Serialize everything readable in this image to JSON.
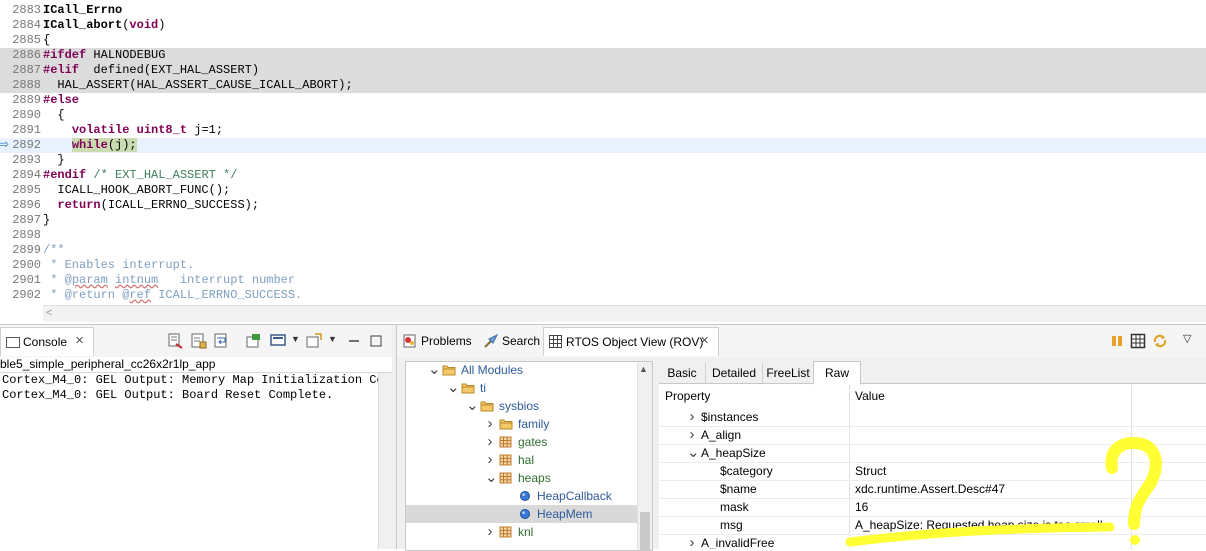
{
  "editor": {
    "lines": [
      {
        "num": "2883",
        "segments": [
          {
            "t": "ICall_Errno",
            "c": "fnb"
          }
        ]
      },
      {
        "num": "2884",
        "segments": [
          {
            "t": "ICall_abort",
            "c": "fnb"
          },
          {
            "t": "("
          },
          {
            "t": "void",
            "c": "kw"
          },
          {
            "t": ")"
          }
        ]
      },
      {
        "num": "2885",
        "segments": [
          {
            "t": "{"
          }
        ]
      },
      {
        "num": "2886",
        "bg": "shade",
        "segments": [
          {
            "t": "#ifdef",
            "c": "pp"
          },
          {
            "t": " HALNODEBUG"
          }
        ]
      },
      {
        "num": "2887",
        "bg": "shade",
        "segments": [
          {
            "t": "#elif",
            "c": "pp"
          },
          {
            "t": "  defined(EXT_HAL_ASSERT)"
          }
        ]
      },
      {
        "num": "2888",
        "bg": "shade",
        "segments": [
          {
            "t": "  HAL_ASSERT(HAL_ASSERT_CAUSE_ICALL_ABORT);"
          }
        ]
      },
      {
        "num": "2889",
        "segments": [
          {
            "t": "#else",
            "c": "pp"
          }
        ]
      },
      {
        "num": "2890",
        "segments": [
          {
            "t": "  {"
          }
        ]
      },
      {
        "num": "2891",
        "segments": [
          {
            "t": "    "
          },
          {
            "t": "volatile",
            "c": "kw"
          },
          {
            "t": " "
          },
          {
            "t": "uint8_t",
            "c": "kw"
          },
          {
            "t": " j=1;"
          }
        ]
      },
      {
        "num": "2892",
        "bg": "current",
        "segments": [
          {
            "t": "    "
          },
          {
            "t": "while",
            "c": "kw hl-while"
          },
          {
            "t": "(j);",
            "c": "hl-while"
          }
        ]
      },
      {
        "num": "2893",
        "segments": [
          {
            "t": "  }"
          }
        ]
      },
      {
        "num": "2894",
        "segments": [
          {
            "t": "#endif",
            "c": "pp"
          },
          {
            "t": " /* EXT_HAL_ASSERT */",
            "c": "cm"
          }
        ]
      },
      {
        "num": "2895",
        "segments": [
          {
            "t": "  ICALL_HOOK_ABORT_FUNC();"
          }
        ]
      },
      {
        "num": "2896",
        "segments": [
          {
            "t": "  "
          },
          {
            "t": "return",
            "c": "kw"
          },
          {
            "t": "(ICALL_ERRNO_SUCCESS);"
          }
        ]
      },
      {
        "num": "2897",
        "segments": [
          {
            "t": "}"
          }
        ]
      },
      {
        "num": "2898",
        "segments": []
      },
      {
        "num": "2899",
        "segments": [
          {
            "t": "/**",
            "c": "jd"
          }
        ]
      },
      {
        "num": "2900",
        "segments": [
          {
            "t": " * Enables interrupt.",
            "c": "jd"
          }
        ]
      },
      {
        "num": "2901",
        "segments": [
          {
            "t": " * @",
            "c": "jd"
          },
          {
            "t": "param",
            "c": "jd squig"
          },
          {
            "t": " ",
            "c": "jd"
          },
          {
            "t": "intnum",
            "c": "jd squig"
          },
          {
            "t": "   interrupt number",
            "c": "jd"
          }
        ]
      },
      {
        "num": "2902",
        "segments": [
          {
            "t": " * @return @",
            "c": "jd"
          },
          {
            "t": "ref",
            "c": "jd squig"
          },
          {
            "t": " ICALL_ERRNO_SUCCESS.",
            "c": "jd"
          }
        ]
      }
    ],
    "scroll_left": "<"
  },
  "console": {
    "tab_label": "Console",
    "close": "✕",
    "subtitle": "ble5_simple_peripheral_cc26x2r1lp_app",
    "lines": [
      "Cortex_M4_0: GEL Output: Memory Map Initialization Co",
      "Cortex_M4_0: GEL Output: Board Reset Complete."
    ]
  },
  "rov": {
    "tabs": {
      "problems": "Problems",
      "search": "Search",
      "rov": "RTOS Object View (ROV)",
      "close": "✕"
    },
    "tree": [
      {
        "label": "All Modules",
        "level": 0,
        "tw": "v",
        "icon": "folder",
        "type": "folder"
      },
      {
        "label": "ti",
        "level": 1,
        "tw": "v",
        "icon": "folder",
        "type": "folder"
      },
      {
        "label": "sysbios",
        "level": 2,
        "tw": "v",
        "icon": "folder",
        "type": "folder"
      },
      {
        "label": "family",
        "level": 3,
        "tw": ">",
        "icon": "folder",
        "type": "folder"
      },
      {
        "label": "gates",
        "level": 3,
        "tw": ">",
        "icon": "grid",
        "type": "mod"
      },
      {
        "label": "hal",
        "level": 3,
        "tw": ">",
        "icon": "grid",
        "type": "mod"
      },
      {
        "label": "heaps",
        "level": 3,
        "tw": "v",
        "icon": "grid",
        "type": "mod"
      },
      {
        "label": "HeapCallback",
        "level": 4,
        "tw": "",
        "icon": "dot",
        "type": "leaf"
      },
      {
        "label": "HeapMem",
        "level": 4,
        "tw": "",
        "icon": "dot",
        "type": "leaf",
        "selected": true
      },
      {
        "label": "knl",
        "level": 3,
        "tw": ">",
        "icon": "grid",
        "type": "mod"
      }
    ],
    "ptabs": [
      "Basic",
      "Detailed",
      "FreeList",
      "Raw"
    ],
    "active_ptab": "Raw",
    "headers": {
      "property": "Property",
      "value": "Value"
    },
    "rows": [
      {
        "prop": "$instances",
        "value": "",
        "level": 0,
        "tw": ">"
      },
      {
        "prop": "A_align",
        "value": "",
        "level": 0,
        "tw": ">"
      },
      {
        "prop": "A_heapSize",
        "value": "",
        "level": 0,
        "tw": "v"
      },
      {
        "prop": "$category",
        "value": "Struct",
        "level": 1,
        "tw": ""
      },
      {
        "prop": "$name",
        "value": "xdc.runtime.Assert.Desc#47",
        "level": 1,
        "tw": ""
      },
      {
        "prop": "mask",
        "value": "16",
        "level": 1,
        "tw": ""
      },
      {
        "prop": "msg",
        "value": "A_heapSize: Requested heap size is too small",
        "level": 1,
        "tw": ""
      },
      {
        "prop": "A_invalidFree",
        "value": "",
        "level": 0,
        "tw": ">"
      }
    ]
  },
  "colors": {
    "annotation": "#ffff33",
    "keyword": "#7f0055",
    "comment": "#3f7f5f",
    "javadoc": "#7f9fbf"
  }
}
